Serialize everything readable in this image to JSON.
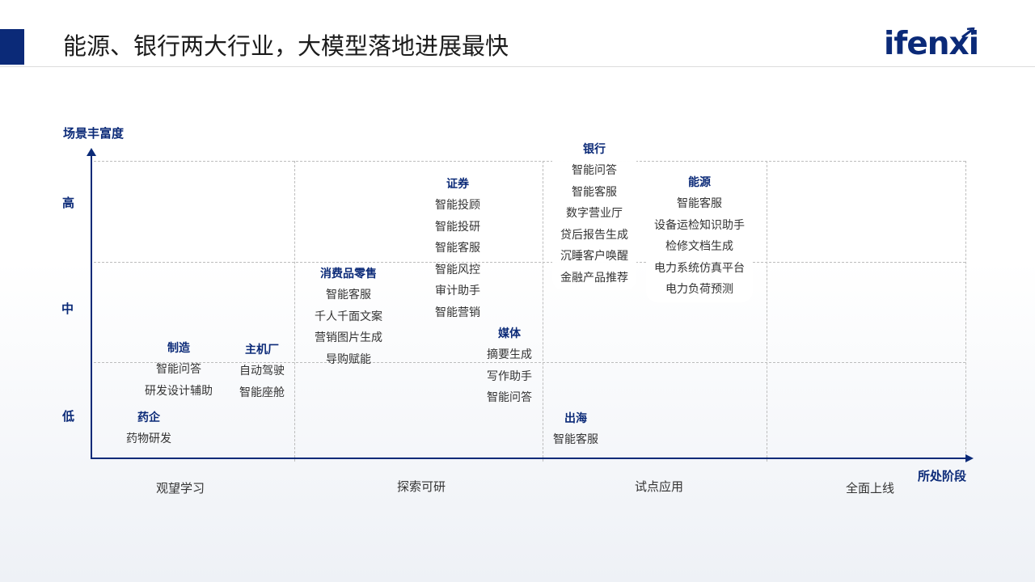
{
  "title": "能源、银行两大行业，大模型落地进展最快",
  "logo": {
    "text": "ifenxi"
  },
  "colors": {
    "brand": "#0b2a78",
    "grid": "#bdbdbd",
    "text": "#333333"
  },
  "diagram": {
    "y_axis": {
      "label": "场景丰富度",
      "levels": [
        "高",
        "中",
        "低"
      ]
    },
    "x_axis": {
      "label": "所处阶段",
      "stages": [
        "观望学习",
        "探索可研",
        "试点应用",
        "全面上线"
      ]
    },
    "groups": [
      {
        "id": "pharma",
        "title": "药企",
        "items": [
          "药物研发"
        ]
      },
      {
        "id": "manufacturing",
        "title": "制造",
        "items": [
          "智能问答",
          "研发设计辅助"
        ]
      },
      {
        "id": "oem",
        "title": "主机厂",
        "items": [
          "自动驾驶",
          "智能座舱"
        ]
      },
      {
        "id": "retail",
        "title": "消费品零售",
        "items": [
          "智能客服",
          "千人千面文案",
          "营销图片生成",
          "导购赋能"
        ]
      },
      {
        "id": "securities",
        "title": "证券",
        "items": [
          "智能投顾",
          "智能投研",
          "智能客服",
          "智能风控",
          "审计助手",
          "智能营销"
        ]
      },
      {
        "id": "media",
        "title": "媒体",
        "items": [
          "摘要生成",
          "写作助手",
          "智能问答"
        ]
      },
      {
        "id": "overseas",
        "title": "出海",
        "items": [
          "智能客服"
        ]
      },
      {
        "id": "banking",
        "title": "银行",
        "items": [
          "智能问答",
          "智能客服",
          "数字营业厅",
          "贷后报告生成",
          "沉睡客户唤醒",
          "金融产品推荐"
        ]
      },
      {
        "id": "energy",
        "title": "能源",
        "items": [
          "智能客服",
          "设备运检知识助手",
          "检修文档生成",
          "电力系统仿真平台",
          "电力负荷预测"
        ]
      }
    ]
  }
}
